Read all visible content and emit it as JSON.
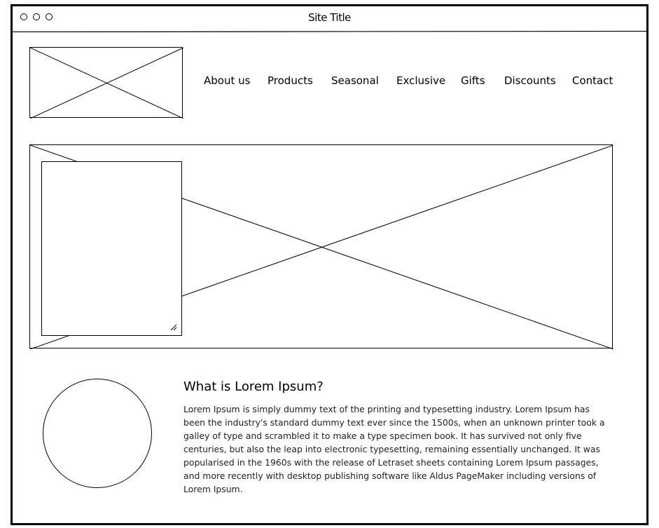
{
  "window": {
    "title": "Site Title",
    "controls": [
      "window-dot",
      "window-dot",
      "window-dot"
    ]
  },
  "header": {
    "logo_icon": "image-placeholder-icon"
  },
  "nav": {
    "items": [
      {
        "label": "About us"
      },
      {
        "label": "Products"
      },
      {
        "label": "Seasonal"
      },
      {
        "label": "Exclusive"
      },
      {
        "label": "Gifts"
      },
      {
        "label": "Discounts"
      },
      {
        "label": "Contact"
      }
    ]
  },
  "hero": {
    "image_icon": "image-placeholder-icon",
    "textarea_value": ""
  },
  "article": {
    "heading": "What is Lorem Ipsum?",
    "body": "Lorem Ipsum is simply dummy text of the printing and typesetting industry. Lorem Ipsum has been the industry's standard dummy text ever since the 1500s, when an unknown printer took a galley of type and scrambled it to make a type specimen book. It has survived not only five centuries, but also the leap into electronic typesetting, remaining essentially unchanged. It was popularised in the 1960s with the release of Letraset sheets containing Lorem Ipsum passages, and more recently with desktop publishing software like Aldus PageMaker including versions of Lorem Ipsum."
  }
}
